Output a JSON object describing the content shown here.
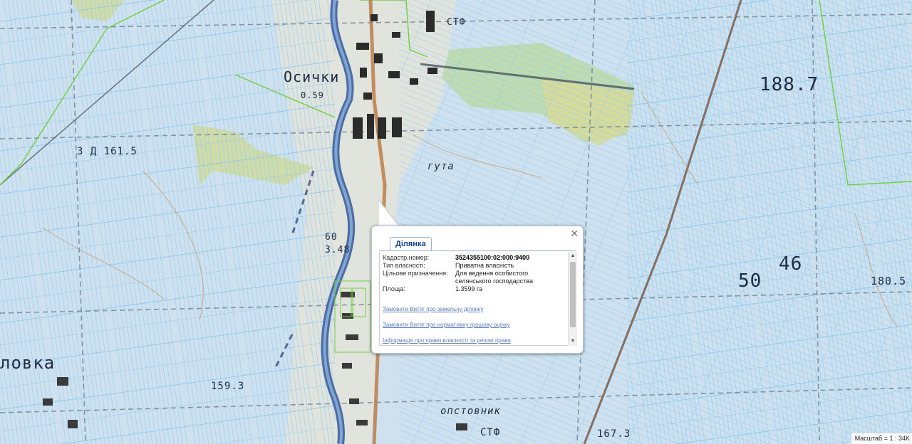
{
  "map": {
    "labels": [
      {
        "text": "Осички",
        "name": "label-osychky"
      },
      {
        "text": "0.59",
        "name": "label-elev-059"
      },
      {
        "text": "СТФ",
        "name": "label-stf-top"
      },
      {
        "text": "188.7",
        "name": "label-elev-1887"
      },
      {
        "text": "3 Д 161.5",
        "name": "label-elev-1615"
      },
      {
        "text": "гута",
        "name": "label-huta"
      },
      {
        "text": "50",
        "name": "label-50"
      },
      {
        "text": "46",
        "name": "label-46"
      },
      {
        "text": "180.5",
        "name": "label-elev-1805"
      },
      {
        "text": "159.3",
        "name": "label-elev-1593"
      },
      {
        "text": "ловка",
        "name": "label-lovka"
      },
      {
        "text": "опстовник",
        "name": "label-opstovnyk"
      },
      {
        "text": "СТФ",
        "name": "label-stf-bottom"
      },
      {
        "text": "167.3",
        "name": "label-elev-1673"
      },
      {
        "text": "60",
        "name": "label-60"
      },
      {
        "text": "3.48",
        "name": "label-348"
      }
    ]
  },
  "popup": {
    "tab_label": "Ділянка",
    "close_glyph": "✕",
    "fields": [
      {
        "label": "Кадастр.номер:",
        "value": "3524355100:02:000:9400"
      },
      {
        "label": "Тип власності:",
        "value": "Приватна власність"
      },
      {
        "label": "Цільове призначення:",
        "value": "Для ведення особистого селянського господарства"
      },
      {
        "label": "Площа:",
        "value": "1.3599 га"
      }
    ],
    "links": [
      "Замовити Витяг про земельну ділянку",
      "Замовити Витяг про нормативну грошову оцінку",
      "Інформація про право власності та речові права"
    ]
  },
  "scale": {
    "text": "Масштаб = 1 : 34K"
  }
}
